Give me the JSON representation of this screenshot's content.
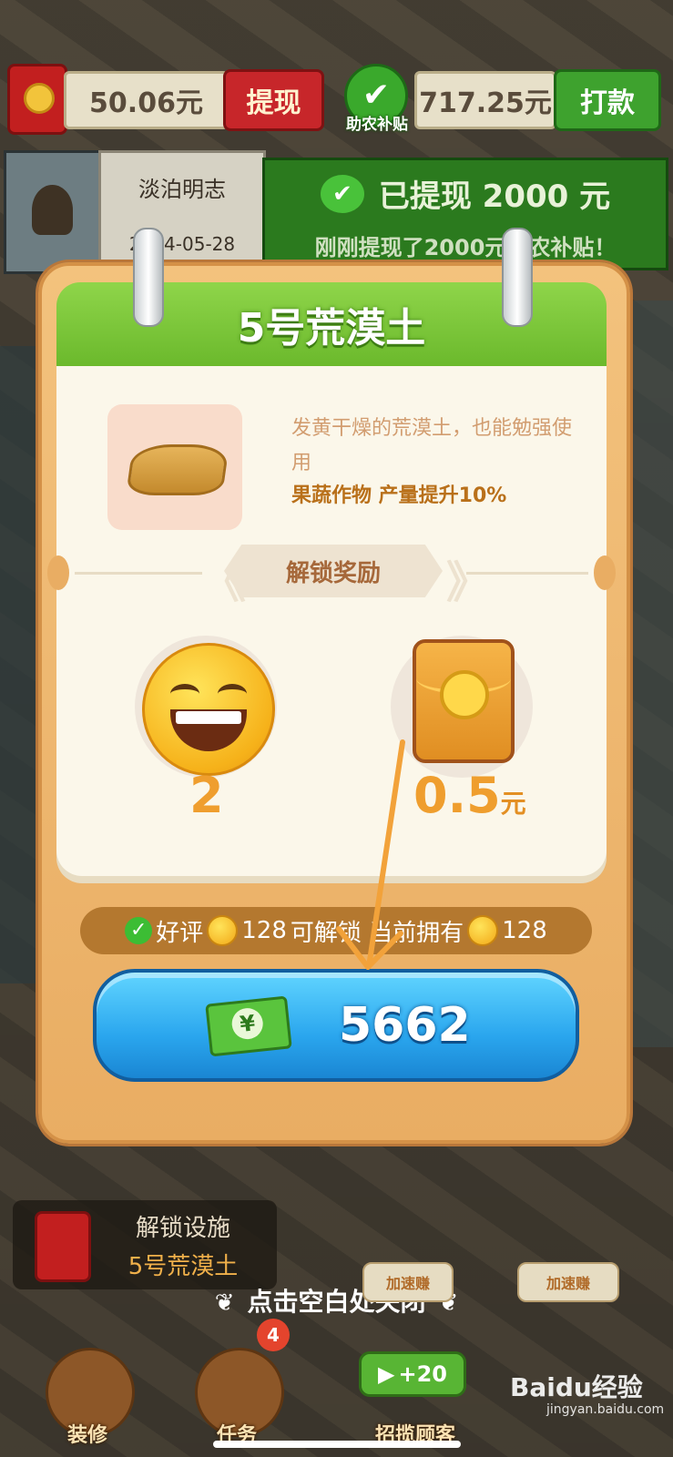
{
  "top_bar": {
    "cash_value": "50.06元",
    "withdraw_label": "提现",
    "subsidy_label": "助农补贴",
    "subsidy_value": "717.25元",
    "pay_label": "打款"
  },
  "notice": {
    "name": "淡泊明志",
    "date": "2024-05-28",
    "headline": "已提现 2000 元",
    "subline": "刚刚提现了2000元助农补贴！"
  },
  "modal": {
    "title": "5号荒漠土",
    "description": "发黄干燥的荒漠土，也能勉强使用",
    "boost_text": "果蔬作物 产量提升10%",
    "reward_header": "解锁奖励",
    "rewards": [
      {
        "icon": "smile-emoji-icon",
        "value": "2",
        "unit": ""
      },
      {
        "icon": "red-packet-icon",
        "value": "0.5",
        "unit": "元"
      }
    ],
    "condition": {
      "prefix": "好评",
      "required": "128",
      "middle": "可解锁 当前拥有",
      "owned": "128"
    },
    "unlock_price": "5662"
  },
  "bottom": {
    "hint_title": "解锁设施",
    "hint_subtitle": "5号荒漠土",
    "close_hint": "点击空白处关闭",
    "nav": [
      {
        "label": "装修"
      },
      {
        "label": "任务",
        "badge": "4"
      },
      {
        "label": "招揽顾客"
      }
    ],
    "speed_left": "加速赚",
    "speed_right": "加速赚",
    "plus_value": "+20",
    "watermark": "Baidu经验",
    "watermark_sub": "jingyan.baidu.com"
  },
  "colors": {
    "header_green": "#6bb92c",
    "button_blue": "#2aa6ee",
    "modal_orange": "#e9ad63",
    "reward_orange": "#ef9e2e"
  }
}
